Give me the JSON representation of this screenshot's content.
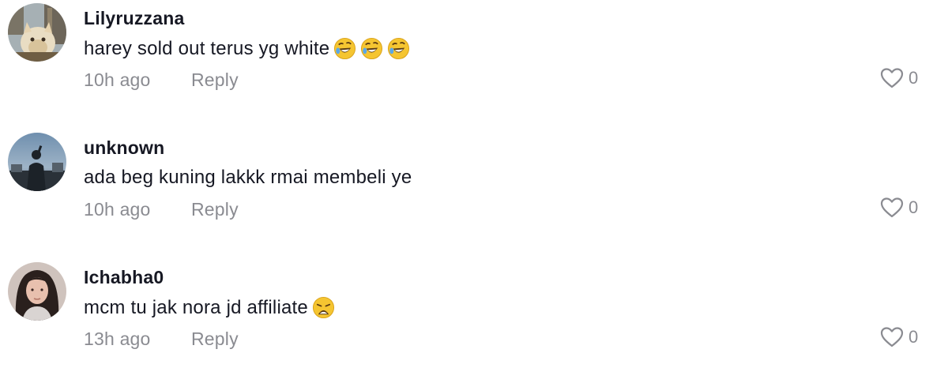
{
  "comments": [
    {
      "username": "Lilyruzzana",
      "text": "harey sold out terus yg white",
      "emojis": [
        "rolling-on-floor-laughing-emoji",
        "rolling-on-floor-laughing-emoji",
        "rolling-on-floor-laughing-emoji"
      ],
      "time": "10h ago",
      "reply_label": "Reply",
      "like_count": "0",
      "avatar": "cat-avatar"
    },
    {
      "username": "unknown",
      "text": "ada beg kuning lakkk rmai membeli ye",
      "emojis": [],
      "time": "10h ago",
      "reply_label": "Reply",
      "like_count": "0",
      "avatar": "silhouette-avatar"
    },
    {
      "username": "Ichabha0",
      "text": "mcm tu jak nora jd affiliate",
      "emojis": [
        "weary-face-emoji"
      ],
      "time": "13h ago",
      "reply_label": "Reply",
      "like_count": "0",
      "avatar": "woman-avatar"
    }
  ],
  "colors": {
    "text": "#161823",
    "muted": "#8a8b91",
    "emoji": "#f5c531"
  }
}
